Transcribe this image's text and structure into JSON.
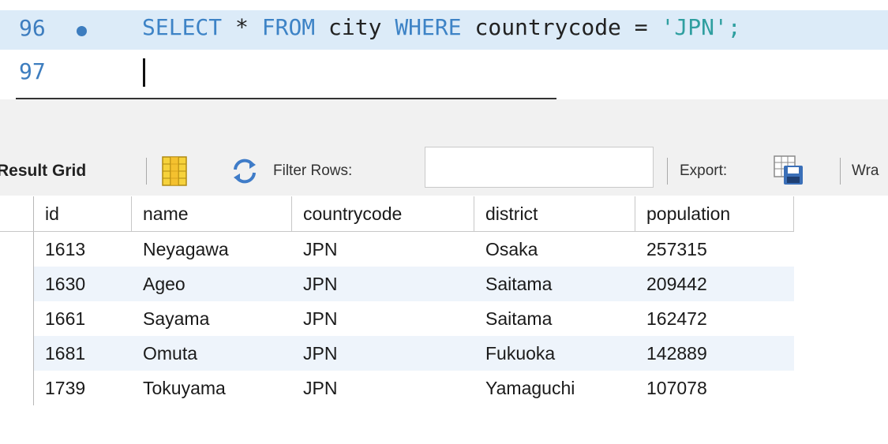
{
  "editor": {
    "lines": [
      {
        "number": "96",
        "has_marker": true
      },
      {
        "number": "97",
        "has_marker": false
      }
    ],
    "query": {
      "kw_select": "SELECT",
      "star": " * ",
      "kw_from": "FROM",
      "table": " city ",
      "kw_where": "WHERE",
      "condition": " countrycode = ",
      "literal": "'JPN';"
    }
  },
  "toolbar": {
    "result_grid_label": "Result Grid",
    "filter_label": "Filter Rows:",
    "filter_value": "",
    "export_label": "Export:",
    "wrap_label": "Wra",
    "icons": [
      "grid-layout-icon",
      "refresh-icon",
      "export-icon"
    ]
  },
  "results": {
    "columns": [
      "id",
      "name",
      "countrycode",
      "district",
      "population"
    ],
    "rows": [
      [
        "1613",
        "Neyagawa",
        "JPN",
        "Osaka",
        "257315"
      ],
      [
        "1630",
        "Ageo",
        "JPN",
        "Saitama",
        "209442"
      ],
      [
        "1661",
        "Sayama",
        "JPN",
        "Saitama",
        "162472"
      ],
      [
        "1681",
        "Omuta",
        "JPN",
        "Fukuoka",
        "142889"
      ],
      [
        "1739",
        "Tokuyama",
        "JPN",
        "Yamaguchi",
        "107078"
      ]
    ]
  },
  "colors": {
    "line_highlight": "#dcebf8",
    "keyword": "#3d83c6",
    "string": "#2f9fa0",
    "line_number": "#3d7dbf",
    "alt_row": "#eef4fb"
  }
}
